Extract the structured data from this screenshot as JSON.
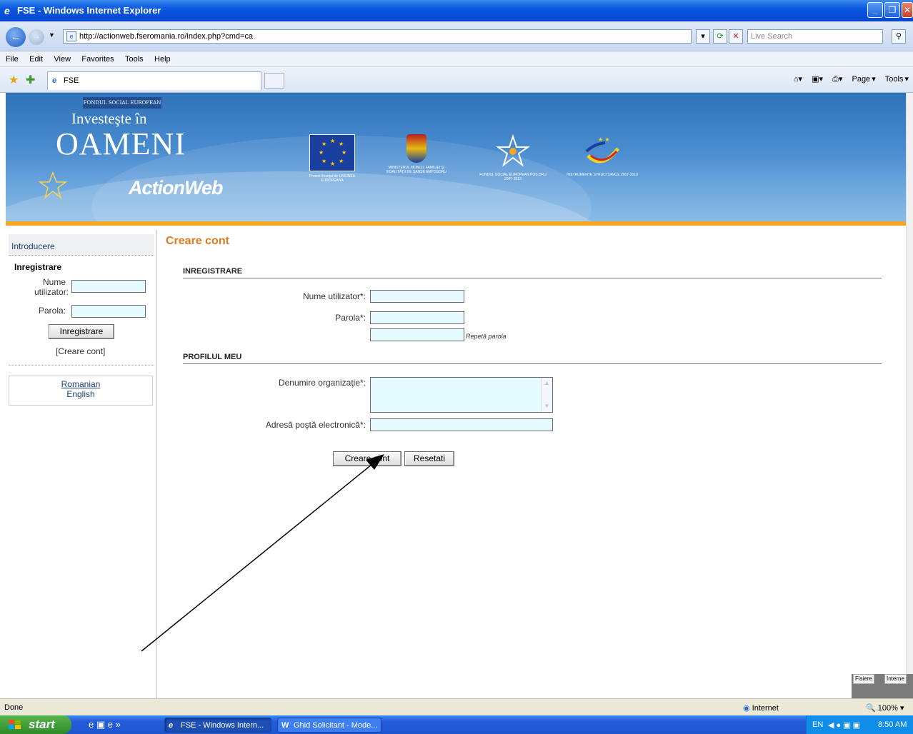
{
  "window": {
    "title": "FSE - Windows Internet Explorer"
  },
  "address": {
    "url": "http://actionweb.fseromania.ro/index.php?cmd=ca",
    "search_placeholder": "Live Search"
  },
  "menu": [
    "File",
    "Edit",
    "View",
    "Favorites",
    "Tools",
    "Help"
  ],
  "tab": {
    "label": "FSE"
  },
  "toolbar": {
    "page_label": "Page",
    "tools_label": "Tools"
  },
  "banner": {
    "fse_tag": "FONDUL SOCIAL EUROPEAN",
    "tagline": "Investeşte în",
    "headline": "OAMENI",
    "brand": "ActionWeb",
    "partners": [
      {
        "caption": "Proiect finanţat de UNIUNEA EUROPEANĂ"
      },
      {
        "caption": "MINISTERUL MUNCII, FAMILIEI ŞI EGALITĂŢII DE ŞANSE AMPOSDRU"
      },
      {
        "caption": "FONDUL SOCIAL EUROPEAN POS DRU 2007-2013"
      },
      {
        "caption": "INSTRUMENTE STRUCTURALE 2007-2013"
      }
    ]
  },
  "sidebar": {
    "intro": "Introducere",
    "reg_title": "Inregistrare",
    "user_label_1": "Nume",
    "user_label_2": "utilizator:",
    "pass_label": "Parola:",
    "reg_button": "Inregistrare",
    "create_link": "[Creare cont]",
    "lang_ro": "Romanian",
    "lang_en": "English"
  },
  "form": {
    "title": "Creare cont",
    "section_reg": "INREGISTRARE",
    "user_label": "Nume utilizator*:",
    "pass_label": "Parola*:",
    "repeat_hint": "Repetă parola",
    "section_profile": "PROFILUL MEU",
    "org_label": "Denumire organizaţie*:",
    "email_label": "Adresă poştă electronică*:",
    "submit": "Creare cont",
    "reset": "Resetati"
  },
  "status": {
    "left": "Done",
    "zone": "Internet",
    "zoom": "100%"
  },
  "mini_overlay": {
    "a": "Fisiere",
    "b": "Interne"
  },
  "taskbar": {
    "start": "start",
    "tasks": [
      "FSE - Windows Intern...",
      "Ghid Solicitant - Mode..."
    ],
    "lang": "EN",
    "time": "8:50 AM"
  }
}
